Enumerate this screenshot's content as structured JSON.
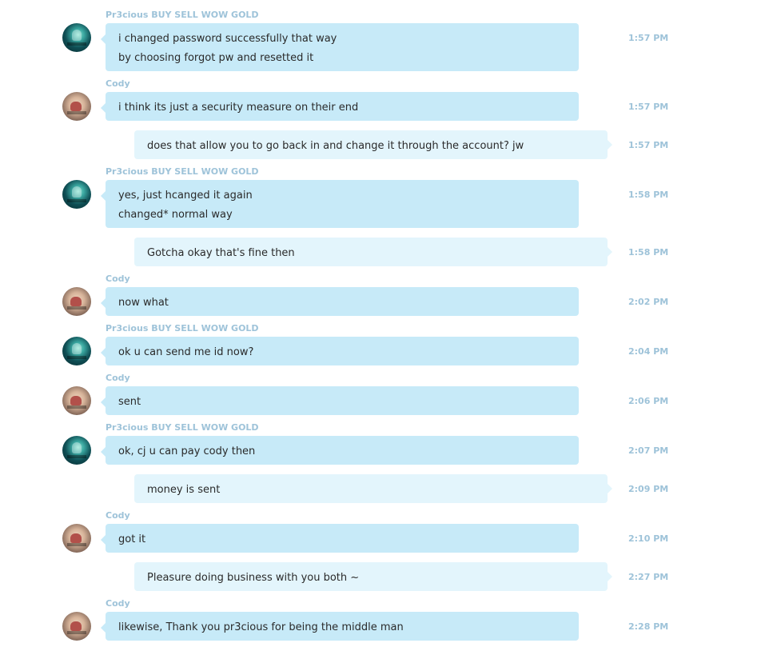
{
  "messages": [
    {
      "sender": "Pr3cious BUY SELL WOW GOLD",
      "direction": "in",
      "avatar": "precious",
      "lines": [
        "i changed password successfully that way",
        "by choosing forgot pw and resetted it"
      ],
      "time": "1:57 PM"
    },
    {
      "sender": "Cody",
      "direction": "in",
      "avatar": "cody",
      "lines": [
        "i think its just a security measure on their end"
      ],
      "time": "1:57 PM"
    },
    {
      "sender": "",
      "direction": "out",
      "avatar": "",
      "lines": [
        "does that allow you to go back in and change it through the account? jw"
      ],
      "time": "1:57 PM"
    },
    {
      "sender": "Pr3cious BUY SELL WOW GOLD",
      "direction": "in",
      "avatar": "precious",
      "lines": [
        "yes, just hcanged it again",
        "changed* normal way"
      ],
      "time": "1:58 PM"
    },
    {
      "sender": "",
      "direction": "out",
      "avatar": "",
      "lines": [
        "Gotcha okay that's fine then"
      ],
      "time": "1:58 PM"
    },
    {
      "sender": "Cody",
      "direction": "in",
      "avatar": "cody",
      "lines": [
        "now what"
      ],
      "time": "2:02 PM"
    },
    {
      "sender": "Pr3cious BUY SELL WOW GOLD",
      "direction": "in",
      "avatar": "precious",
      "lines": [
        "ok u can send me id now?"
      ],
      "time": "2:04 PM"
    },
    {
      "sender": "Cody",
      "direction": "in",
      "avatar": "cody",
      "lines": [
        "sent"
      ],
      "time": "2:06 PM"
    },
    {
      "sender": "Pr3cious BUY SELL WOW GOLD",
      "direction": "in",
      "avatar": "precious",
      "lines": [
        "ok, cj u can pay cody then"
      ],
      "time": "2:07 PM"
    },
    {
      "sender": "",
      "direction": "out",
      "avatar": "",
      "lines": [
        "money is sent"
      ],
      "time": "2:09 PM"
    },
    {
      "sender": "Cody",
      "direction": "in",
      "avatar": "cody",
      "lines": [
        "got it"
      ],
      "time": "2:10 PM"
    },
    {
      "sender": "",
      "direction": "out",
      "avatar": "",
      "lines": [
        "Pleasure doing business with you both ~"
      ],
      "time": "2:27 PM"
    },
    {
      "sender": "Cody",
      "direction": "in",
      "avatar": "cody",
      "lines": [
        "likewise, Thank you pr3cious for being the middle man"
      ],
      "time": "2:28 PM"
    }
  ]
}
